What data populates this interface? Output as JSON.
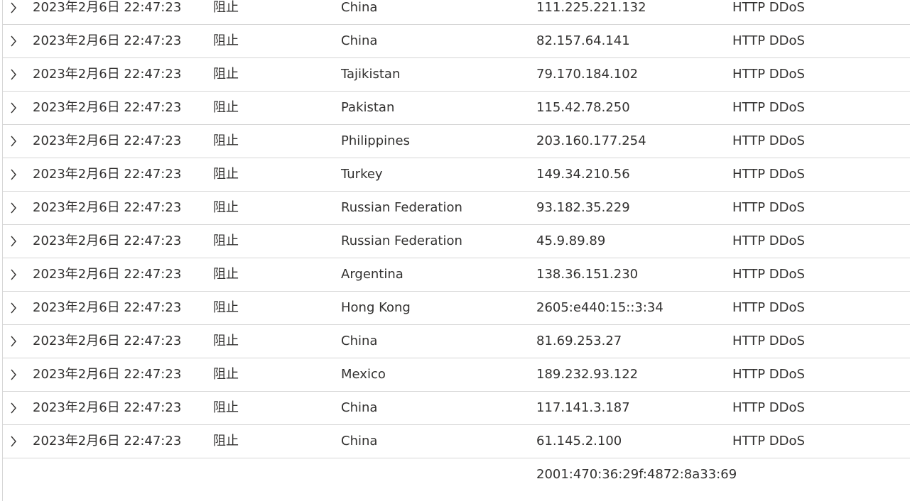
{
  "rows": [
    {
      "time": "2023年2月6日 22:47:23",
      "action": "阻止",
      "country": "China",
      "ip": "111.225.221.132",
      "rule": "HTTP DDoS"
    },
    {
      "time": "2023年2月6日 22:47:23",
      "action": "阻止",
      "country": "China",
      "ip": "82.157.64.141",
      "rule": "HTTP DDoS"
    },
    {
      "time": "2023年2月6日 22:47:23",
      "action": "阻止",
      "country": "Tajikistan",
      "ip": "79.170.184.102",
      "rule": "HTTP DDoS"
    },
    {
      "time": "2023年2月6日 22:47:23",
      "action": "阻止",
      "country": "Pakistan",
      "ip": "115.42.78.250",
      "rule": "HTTP DDoS"
    },
    {
      "time": "2023年2月6日 22:47:23",
      "action": "阻止",
      "country": "Philippines",
      "ip": "203.160.177.254",
      "rule": "HTTP DDoS"
    },
    {
      "time": "2023年2月6日 22:47:23",
      "action": "阻止",
      "country": "Turkey",
      "ip": "149.34.210.56",
      "rule": "HTTP DDoS"
    },
    {
      "time": "2023年2月6日 22:47:23",
      "action": "阻止",
      "country": "Russian Federation",
      "ip": "93.182.35.229",
      "rule": "HTTP DDoS"
    },
    {
      "time": "2023年2月6日 22:47:23",
      "action": "阻止",
      "country": "Russian Federation",
      "ip": "45.9.89.89",
      "rule": "HTTP DDoS"
    },
    {
      "time": "2023年2月6日 22:47:23",
      "action": "阻止",
      "country": "Argentina",
      "ip": "138.36.151.230",
      "rule": "HTTP DDoS"
    },
    {
      "time": "2023年2月6日 22:47:23",
      "action": "阻止",
      "country": "Hong Kong",
      "ip": "2605:e440:15::3:34",
      "rule": "HTTP DDoS"
    },
    {
      "time": "2023年2月6日 22:47:23",
      "action": "阻止",
      "country": "China",
      "ip": "81.69.253.27",
      "rule": "HTTP DDoS"
    },
    {
      "time": "2023年2月6日 22:47:23",
      "action": "阻止",
      "country": "Mexico",
      "ip": "189.232.93.122",
      "rule": "HTTP DDoS"
    },
    {
      "time": "2023年2月6日 22:47:23",
      "action": "阻止",
      "country": "China",
      "ip": "117.141.3.187",
      "rule": "HTTP DDoS"
    },
    {
      "time": "2023年2月6日 22:47:23",
      "action": "阻止",
      "country": "China",
      "ip": "61.145.2.100",
      "rule": "HTTP DDoS"
    }
  ],
  "partial_row": {
    "ip": "2001:470:36:29f:4872:8a33:69"
  },
  "icons": {
    "expand": "chevron-right-icon"
  }
}
